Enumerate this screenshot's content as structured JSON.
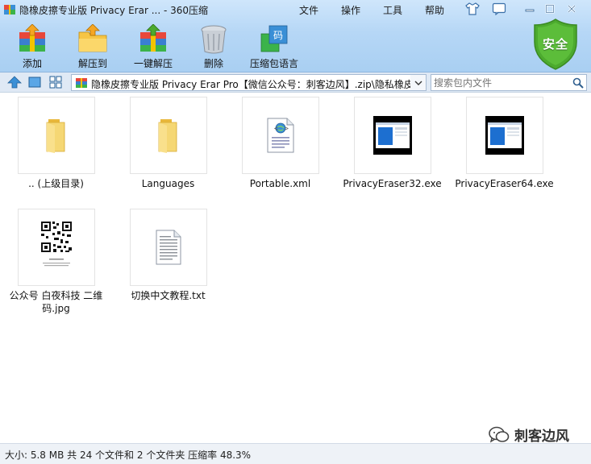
{
  "window": {
    "title": "隐橡皮擦专业版 Privacy Erar ... - 360压缩",
    "menus": [
      "文件",
      "操作",
      "工具",
      "帮助"
    ]
  },
  "toolbar": {
    "add": "添加",
    "extract_to": "解压到",
    "one_click_extract": "一键解压",
    "delete": "删除",
    "comment": "压缩包语言",
    "security_badge": "安全"
  },
  "address": {
    "path": "隐橡皮擦专业版 Privacy Erar Pro【微信公众号：刺客边风】.zip\\隐私橡皮擦",
    "search_placeholder": "搜索包内文件"
  },
  "files": [
    {
      "name": ".. (上级目录)",
      "type": "folder-icon"
    },
    {
      "name": "Languages",
      "type": "folder-icon"
    },
    {
      "name": "Portable.xml",
      "type": "xml-file-icon"
    },
    {
      "name": "PrivacyEraser32.exe",
      "type": "exe-file-icon"
    },
    {
      "name": "PrivacyEraser64.exe",
      "type": "exe-file-icon"
    },
    {
      "name": "公众号 白夜科技 二维码.jpg",
      "type": "qr-image-thumbnail"
    },
    {
      "name": "切换中文教程.txt",
      "type": "text-file-icon"
    }
  ],
  "status": {
    "text": "大小: 5.8 MB 共 24 个文件和 2 个文件夹 压缩率 48.3%"
  },
  "watermark": {
    "text": "刺客边风"
  },
  "colors": {
    "frame_blue": "#b6d7f6",
    "shield_green": "#4caa2e",
    "folder_yellow": "#f5d774"
  }
}
